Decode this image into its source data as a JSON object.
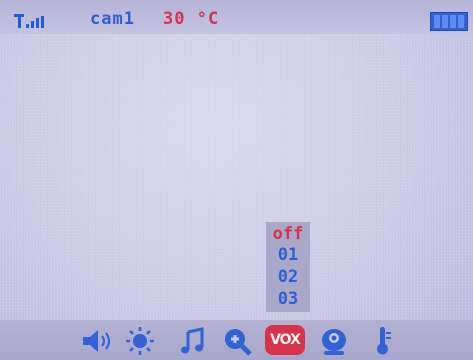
{
  "status_bar": {
    "signal_icon": "signal-strength-icon",
    "camera": "cam1",
    "temperature": "30 °C",
    "battery_icon": "battery-icon",
    "accent_color": "#2a5fd8",
    "alert_color": "#d8324a"
  },
  "menu": {
    "items": [
      "off",
      "01",
      "02",
      "03"
    ],
    "selected": "off"
  },
  "toolbar": {
    "icons": [
      "volume-icon",
      "brightness-icon",
      "music-note-icon",
      "zoom-icon",
      "vox-icon",
      "record-icon",
      "temperature-icon"
    ],
    "vox_label": "VOX"
  }
}
